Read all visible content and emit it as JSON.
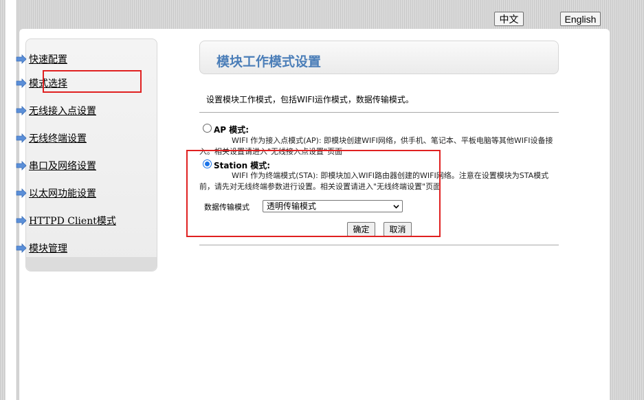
{
  "lang": {
    "chinese": "中文",
    "english": "English"
  },
  "sidebar": {
    "items": [
      {
        "label": "快速配置"
      },
      {
        "label": "模式选择"
      },
      {
        "label": "无线接入点设置"
      },
      {
        "label": "无线终端设置"
      },
      {
        "label": "串口及网络设置"
      },
      {
        "label": "以太网功能设置"
      },
      {
        "label": "HTTPD Client模式"
      },
      {
        "label": "模块管理"
      }
    ]
  },
  "main": {
    "title": "模块工作模式设置",
    "description": "设置模块工作模式，包括WIFI运作模式，数据传输模式。",
    "ap": {
      "label": "AP 模式:",
      "description": "WIFI 作为接入点模式(AP): 即模块创建WIFI网络，供手机、笔记本、平板电脑等其他WIFI设备接入。相关设置请进入\"无线接入点设置\"页面",
      "checked": false
    },
    "station": {
      "label": "Station 模式:",
      "description": "WIFI 作为终端模式(STA): 即模块加入WIFI路由器创建的WIFI网络。注意在设置模块为STA模式前，请先对无线终端参数进行设置。相关设置请进入\"无线终端设置\"页面",
      "checked": true
    },
    "transfer": {
      "label": "数据传输模式",
      "value": "透明传输模式"
    },
    "buttons": {
      "ok": "确定",
      "cancel": "取消"
    }
  },
  "colors": {
    "accent": "#4b7eb8",
    "arrow": "#5b8fd8",
    "highlight": "#e02020"
  },
  "icons": {
    "nav": "arrow-right-icon",
    "select": "chevron-down-icon"
  }
}
